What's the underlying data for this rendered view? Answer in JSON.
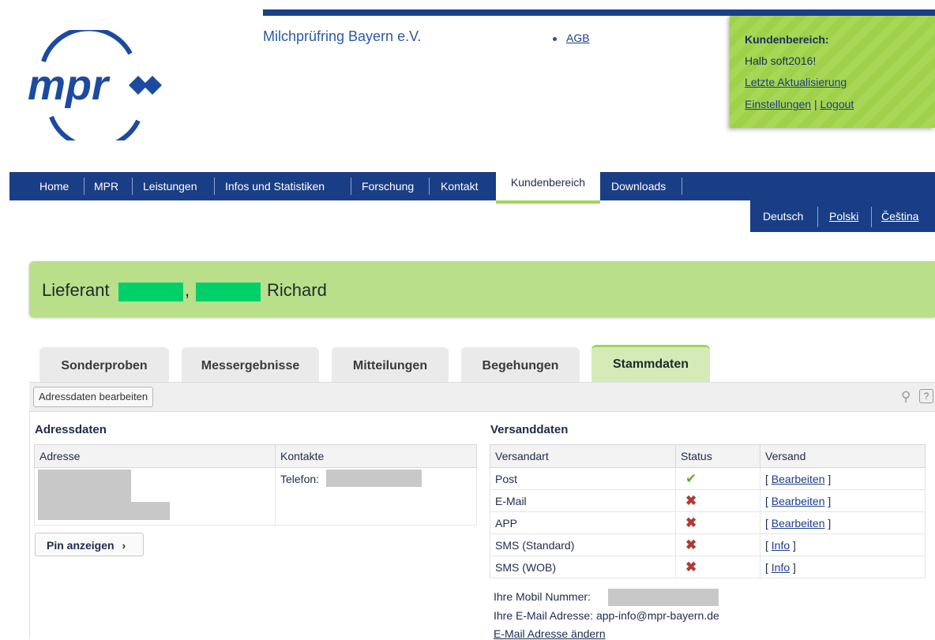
{
  "header": {
    "org_name": "Milchprüfring Bayern e.V.",
    "agb": "AGB",
    "logo_text": "mpr"
  },
  "kundenbereich": {
    "title": "Kundenbereich:",
    "greeting": "Halb soft2016!",
    "last_update": "Letzte Aktualisierung",
    "settings": "Einstellungen",
    "sep": "|",
    "logout": "Logout"
  },
  "nav": {
    "items": [
      "Home",
      "MPR",
      "Leistungen",
      "Infos und Statistiken",
      "Forschung",
      "Kontakt",
      "Kundenbereich",
      "Downloads"
    ],
    "active": "Kundenbereich"
  },
  "languages": [
    "Deutsch",
    "Polski",
    "Čeština"
  ],
  "supplier": {
    "prefix": "Lieferant",
    "comma": ",",
    "first_name": "Richard"
  },
  "tabs": [
    "Sonderproben",
    "Messergebnisse",
    "Mitteilungen",
    "Begehungen",
    "Stammdaten"
  ],
  "toolbar": {
    "edit_button": "Adressdaten bearbeiten",
    "help": "?"
  },
  "address": {
    "title": "Adressdaten",
    "col_address": "Adresse",
    "col_contacts": "Kontakte",
    "phone_label": "Telefon:",
    "pin_button": "Pin anzeigen",
    "pin_arrow": "›"
  },
  "shipping": {
    "title": "Versanddaten",
    "col_type": "Versandart",
    "col_status": "Status",
    "col_send": "Versand",
    "rows": [
      {
        "type": "Post",
        "status": "ok",
        "action": "Bearbeiten"
      },
      {
        "type": "E-Mail",
        "status": "no",
        "action": "Bearbeiten"
      },
      {
        "type": "APP",
        "status": "no",
        "action": "Bearbeiten"
      },
      {
        "type": "SMS (Standard)",
        "status": "no",
        "action": "Info"
      },
      {
        "type": "SMS (WOB)",
        "status": "no",
        "action": "Info"
      }
    ],
    "mobile_label": "Ihre Mobil Nummer:",
    "email_label": "Ihre E-Mail Adresse:",
    "email_value": "app-info@mpr-bayern.de",
    "change_email": "E-Mail Adresse ändern"
  },
  "colors": {
    "navy": "#1a3e85",
    "green": "#a4d45a",
    "redaction_green": "#00d06a"
  }
}
